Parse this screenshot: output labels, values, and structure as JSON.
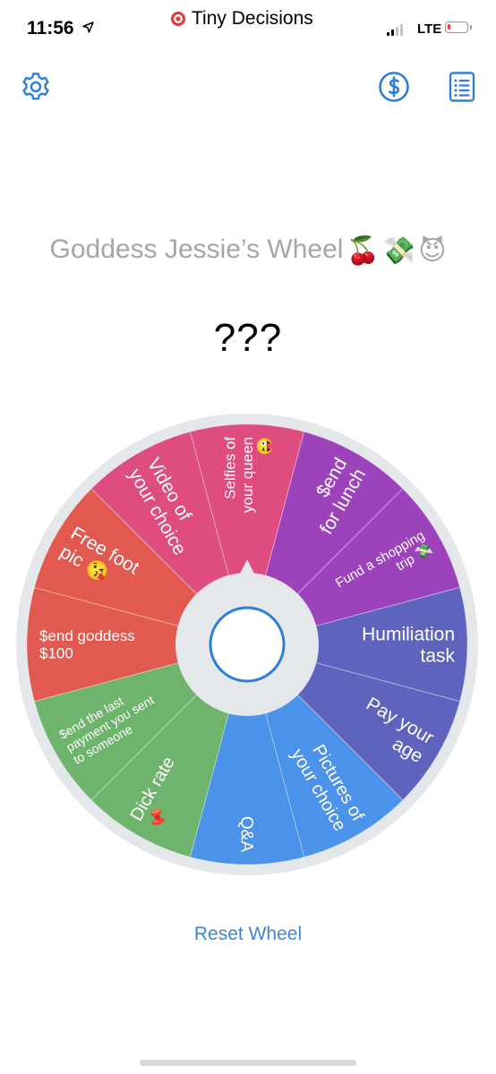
{
  "status_bar": {
    "time": "11:56",
    "app_name": "Tiny Decisions",
    "network": "LTE",
    "battery_level": 0.1,
    "signal_bars": 2,
    "signal_bars_total": 4
  },
  "toolbar": {
    "settings_icon": "gear-icon",
    "premium_icon": "dollar-circle-icon",
    "lists_icon": "list-icon",
    "accent_color": "#2f7fd6"
  },
  "wheel": {
    "title": "Goddess Jessie’s Wheel",
    "title_emojis": [
      "🍒",
      "💸",
      "😈"
    ],
    "result": "???",
    "segments": [
      {
        "label": "Selfies of your queen 😜",
        "color": "#de4c80"
      },
      {
        "label": "$end for lunch",
        "color": "#9c43bc"
      },
      {
        "label": "Fund a shopping trip 💸",
        "color": "#9c43bc"
      },
      {
        "label": "Humiliation task",
        "color": "#5e64bd"
      },
      {
        "label": "Pay your age",
        "color": "#5e64bd"
      },
      {
        "label": "Pictures of your choice",
        "color": "#4b92ea"
      },
      {
        "label": "Q&A",
        "color": "#4b92ea"
      },
      {
        "label": "Dick rate 📌",
        "color": "#6fb46d"
      },
      {
        "label": "$end the last payment you sent to someone",
        "color": "#6fb46d"
      },
      {
        "label": "$end goddess $100",
        "color": "#e2594f"
      },
      {
        "label": "Free foot pic 😘",
        "color": "#e2594f"
      },
      {
        "label": "Video of your choice",
        "color": "#de4c80"
      }
    ]
  },
  "reset_label": "Reset Wheel"
}
